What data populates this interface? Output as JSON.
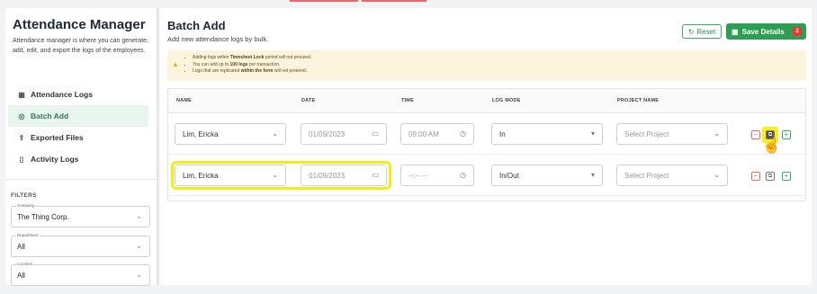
{
  "sidebar": {
    "title": "Attendance Manager",
    "description": "Attendance manager is where you can generate, add, edit, and export the logs of the employees.",
    "nav": [
      {
        "label": "Attendance Logs",
        "icon": "calendar-list-icon",
        "glyph": "▦"
      },
      {
        "label": "Batch Add",
        "icon": "layers-icon",
        "glyph": "◎",
        "active": true
      },
      {
        "label": "Exported Files",
        "icon": "export-icon",
        "glyph": "⇪"
      },
      {
        "label": "Activity Logs",
        "icon": "document-icon",
        "glyph": "▯"
      }
    ],
    "filters_title": "FILTERS",
    "filters": [
      {
        "label": "Company",
        "value": "The Thing Corp."
      },
      {
        "label": "Department",
        "value": "All"
      },
      {
        "label": "Location",
        "value": "All"
      }
    ]
  },
  "header": {
    "title": "Batch Add",
    "subtitle": "Add new attendance logs by bulk.",
    "reset_label": "Reset",
    "save_label": "Save Details",
    "save_badge": "2"
  },
  "notice": {
    "items": [
      {
        "pre": "Adding logs within ",
        "bold": "Timesheet Lock",
        "post": " period will not proceed."
      },
      {
        "pre": "You can add up to ",
        "bold": "100 logs",
        "post": " per transaction."
      },
      {
        "pre": "Logs that are replicated ",
        "bold": "within the form",
        "post": " will not proceed."
      }
    ]
  },
  "table": {
    "headers": [
      "NAME",
      "DATE",
      "TIME",
      "LOG MODE",
      "PROJECT NAME"
    ],
    "rows": [
      {
        "name": "Lim, Ericka",
        "date": "01/09/2023",
        "time": "09:00 AM",
        "log_mode": "In",
        "project": "Select Project"
      },
      {
        "name": "Lim, Ericka",
        "date": "01/09/2023",
        "time": "--:-- --",
        "log_mode": "In/Out",
        "project": "Select Project"
      }
    ],
    "action_symbols": {
      "remove": "−",
      "copy": "⧉",
      "add": "+"
    }
  },
  "colors": {
    "accent": "#2e9e55",
    "danger": "#e53935",
    "highlight": "#f2ec1a",
    "notice_bg": "#fdf4dd"
  }
}
